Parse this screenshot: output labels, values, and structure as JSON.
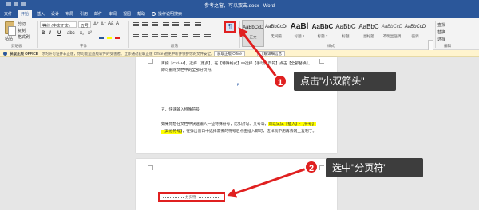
{
  "window": {
    "title": "参考之窗，可以双击.docx - Word"
  },
  "tabs": [
    "文件",
    "开始",
    "插入",
    "设计",
    "布局",
    "引用",
    "邮件",
    "审阅",
    "视图",
    "帮助"
  ],
  "active_tab_index": 1,
  "tell_me": "操作说明搜索",
  "ribbon": {
    "paste_label": "粘贴",
    "clipboard_items": [
      "剪切",
      "复制",
      "格式刷"
    ],
    "clipboard_group": "剪贴板",
    "font_name": "等线 (中文正文)",
    "font_size": "五号",
    "font_buttons": [
      "B",
      "I",
      "U",
      "abc",
      "x₂",
      "x²"
    ],
    "font_top_buttons": [
      "A⁺",
      "A⁻",
      "Aa",
      "A"
    ],
    "font_group": "字体",
    "paragraph_group": "段落",
    "show_hide_symbol": "¶",
    "styles": [
      {
        "preview": "AaBbCcDc",
        "name": "正文"
      },
      {
        "preview": "AaBbCcDc",
        "name": "无间隔"
      },
      {
        "preview": "AaBl",
        "name": "标题 1"
      },
      {
        "preview": "AaBbC",
        "name": "标题 2"
      },
      {
        "preview": "AaBbC",
        "name": "标题"
      },
      {
        "preview": "AaBbC",
        "name": "副标题"
      },
      {
        "preview": "AaBbCcD",
        "name": "不明显强调"
      },
      {
        "preview": "AaBbCcD",
        "name": "强调"
      }
    ],
    "styles_group": "样式",
    "editing_items": [
      "查找",
      "替换",
      "选择"
    ],
    "editing_group": "编辑"
  },
  "message_bar": {
    "title": "获取正版 OFFICE",
    "text": "你的许可证并非正版，你可能是盗版软件的受害者。立即通过获取正版 Office 避免中断并保护你的文件安全。",
    "button1": "获取正版 Office",
    "button2": "了解详细信息"
  },
  "document": {
    "page1_lines": [
      {
        "parts": [
          {
            "t": "再按【Ctrl+H】，选择【更多】，在【特殊格式】中选择【手动分页符】点击【全部替换】，",
            "c": ""
          }
        ]
      },
      {
        "parts": [
          {
            "t": "即可删除文档中的全部分页符。",
            "c": ""
          }
        ]
      },
      {
        "parts": [
          {
            "t": "~p~",
            "c": "blue"
          }
        ]
      },
      {
        "parts": [
          {
            "t": "五、快速输入特殊符号",
            "c": ""
          }
        ]
      },
      {
        "parts": [
          {
            "t": "如果你想在文档中快速输入一些特殊符号，比如对勾、叉号等，",
            "c": ""
          },
          {
            "t": "可以试试【插入】-【符号】",
            "c": "hl"
          }
        ]
      },
      {
        "parts": [
          {
            "t": "【其他符号】",
            "c": "hl"
          },
          {
            "t": "，在弹出窗口中选择需要的符号后点击插入即可，这样就不用再去网上复制了。",
            "c": ""
          }
        ]
      }
    ],
    "page_break_label": "分页符"
  },
  "annotations": [
    {
      "number": "1",
      "text": "点击\"小双箭头\""
    },
    {
      "number": "2",
      "text": "选中\"分页符\""
    }
  ],
  "colors": {
    "word_blue": "#2b579a",
    "annotation_red": "#e02020",
    "bubble_bg": "#3d3d3d",
    "highlight": "#ffff00"
  }
}
